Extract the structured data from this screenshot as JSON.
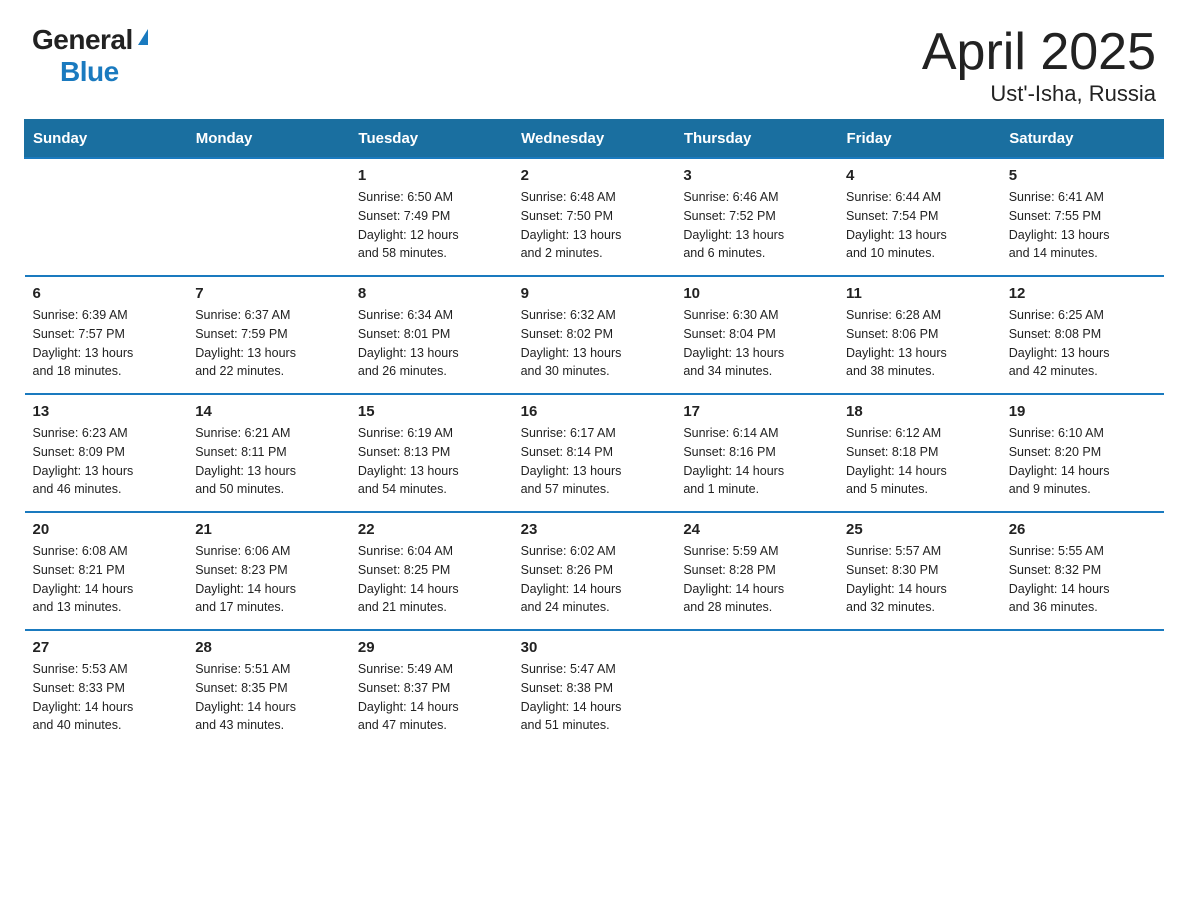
{
  "header": {
    "logo_general": "General",
    "logo_blue": "Blue",
    "title": "April 2025",
    "location": "Ust'-Isha, Russia"
  },
  "weekdays": [
    "Sunday",
    "Monday",
    "Tuesday",
    "Wednesday",
    "Thursday",
    "Friday",
    "Saturday"
  ],
  "weeks": [
    [
      {
        "day": "",
        "info": ""
      },
      {
        "day": "",
        "info": ""
      },
      {
        "day": "1",
        "info": "Sunrise: 6:50 AM\nSunset: 7:49 PM\nDaylight: 12 hours\nand 58 minutes."
      },
      {
        "day": "2",
        "info": "Sunrise: 6:48 AM\nSunset: 7:50 PM\nDaylight: 13 hours\nand 2 minutes."
      },
      {
        "day": "3",
        "info": "Sunrise: 6:46 AM\nSunset: 7:52 PM\nDaylight: 13 hours\nand 6 minutes."
      },
      {
        "day": "4",
        "info": "Sunrise: 6:44 AM\nSunset: 7:54 PM\nDaylight: 13 hours\nand 10 minutes."
      },
      {
        "day": "5",
        "info": "Sunrise: 6:41 AM\nSunset: 7:55 PM\nDaylight: 13 hours\nand 14 minutes."
      }
    ],
    [
      {
        "day": "6",
        "info": "Sunrise: 6:39 AM\nSunset: 7:57 PM\nDaylight: 13 hours\nand 18 minutes."
      },
      {
        "day": "7",
        "info": "Sunrise: 6:37 AM\nSunset: 7:59 PM\nDaylight: 13 hours\nand 22 minutes."
      },
      {
        "day": "8",
        "info": "Sunrise: 6:34 AM\nSunset: 8:01 PM\nDaylight: 13 hours\nand 26 minutes."
      },
      {
        "day": "9",
        "info": "Sunrise: 6:32 AM\nSunset: 8:02 PM\nDaylight: 13 hours\nand 30 minutes."
      },
      {
        "day": "10",
        "info": "Sunrise: 6:30 AM\nSunset: 8:04 PM\nDaylight: 13 hours\nand 34 minutes."
      },
      {
        "day": "11",
        "info": "Sunrise: 6:28 AM\nSunset: 8:06 PM\nDaylight: 13 hours\nand 38 minutes."
      },
      {
        "day": "12",
        "info": "Sunrise: 6:25 AM\nSunset: 8:08 PM\nDaylight: 13 hours\nand 42 minutes."
      }
    ],
    [
      {
        "day": "13",
        "info": "Sunrise: 6:23 AM\nSunset: 8:09 PM\nDaylight: 13 hours\nand 46 minutes."
      },
      {
        "day": "14",
        "info": "Sunrise: 6:21 AM\nSunset: 8:11 PM\nDaylight: 13 hours\nand 50 minutes."
      },
      {
        "day": "15",
        "info": "Sunrise: 6:19 AM\nSunset: 8:13 PM\nDaylight: 13 hours\nand 54 minutes."
      },
      {
        "day": "16",
        "info": "Sunrise: 6:17 AM\nSunset: 8:14 PM\nDaylight: 13 hours\nand 57 minutes."
      },
      {
        "day": "17",
        "info": "Sunrise: 6:14 AM\nSunset: 8:16 PM\nDaylight: 14 hours\nand 1 minute."
      },
      {
        "day": "18",
        "info": "Sunrise: 6:12 AM\nSunset: 8:18 PM\nDaylight: 14 hours\nand 5 minutes."
      },
      {
        "day": "19",
        "info": "Sunrise: 6:10 AM\nSunset: 8:20 PM\nDaylight: 14 hours\nand 9 minutes."
      }
    ],
    [
      {
        "day": "20",
        "info": "Sunrise: 6:08 AM\nSunset: 8:21 PM\nDaylight: 14 hours\nand 13 minutes."
      },
      {
        "day": "21",
        "info": "Sunrise: 6:06 AM\nSunset: 8:23 PM\nDaylight: 14 hours\nand 17 minutes."
      },
      {
        "day": "22",
        "info": "Sunrise: 6:04 AM\nSunset: 8:25 PM\nDaylight: 14 hours\nand 21 minutes."
      },
      {
        "day": "23",
        "info": "Sunrise: 6:02 AM\nSunset: 8:26 PM\nDaylight: 14 hours\nand 24 minutes."
      },
      {
        "day": "24",
        "info": "Sunrise: 5:59 AM\nSunset: 8:28 PM\nDaylight: 14 hours\nand 28 minutes."
      },
      {
        "day": "25",
        "info": "Sunrise: 5:57 AM\nSunset: 8:30 PM\nDaylight: 14 hours\nand 32 minutes."
      },
      {
        "day": "26",
        "info": "Sunrise: 5:55 AM\nSunset: 8:32 PM\nDaylight: 14 hours\nand 36 minutes."
      }
    ],
    [
      {
        "day": "27",
        "info": "Sunrise: 5:53 AM\nSunset: 8:33 PM\nDaylight: 14 hours\nand 40 minutes."
      },
      {
        "day": "28",
        "info": "Sunrise: 5:51 AM\nSunset: 8:35 PM\nDaylight: 14 hours\nand 43 minutes."
      },
      {
        "day": "29",
        "info": "Sunrise: 5:49 AM\nSunset: 8:37 PM\nDaylight: 14 hours\nand 47 minutes."
      },
      {
        "day": "30",
        "info": "Sunrise: 5:47 AM\nSunset: 8:38 PM\nDaylight: 14 hours\nand 51 minutes."
      },
      {
        "day": "",
        "info": ""
      },
      {
        "day": "",
        "info": ""
      },
      {
        "day": "",
        "info": ""
      }
    ]
  ]
}
